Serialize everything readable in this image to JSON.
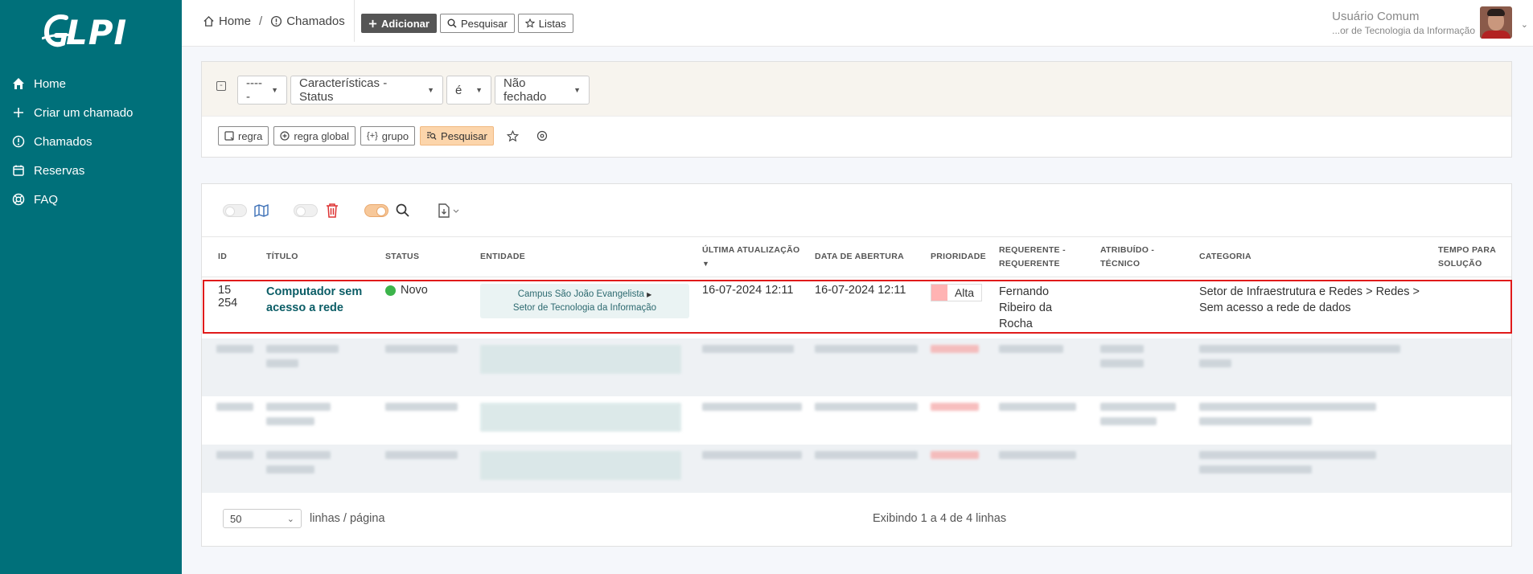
{
  "app": {
    "logo_text": "LPI"
  },
  "sidebar": {
    "items": [
      {
        "label": "Home",
        "icon": "home-icon"
      },
      {
        "label": "Criar um chamado",
        "icon": "plus-icon"
      },
      {
        "label": "Chamados",
        "icon": "alert-circle-icon"
      },
      {
        "label": "Reservas",
        "icon": "calendar-icon"
      },
      {
        "label": "FAQ",
        "icon": "lifebuoy-icon"
      }
    ]
  },
  "header": {
    "breadcrumb": {
      "home": "Home",
      "separator": "/",
      "current": "Chamados"
    },
    "buttons": {
      "add": "Adicionar",
      "search": "Pesquisar",
      "lists": "Listas"
    },
    "user": {
      "name": "Usuário Comum",
      "entity": "...or de Tecnologia da Informação"
    }
  },
  "search": {
    "link_value": "-----",
    "field_value": "Características - Status",
    "operator_value": "é",
    "criteria_value": "Não fechado",
    "buttons": {
      "rule": "regra",
      "global_rule": "regra global",
      "group": "grupo",
      "search": "Pesquisar"
    }
  },
  "table": {
    "headers": {
      "id": "ID",
      "title": "Título",
      "status": "Status",
      "entity": "Entidade",
      "last_update": "Última atualização",
      "opening_date": "Data de abertura",
      "priority": "Prioridade",
      "requester_1": "Requerente -",
      "requester_2": "Requerente",
      "assigned_1": "Atribuído -",
      "assigned_2": "Técnico",
      "category": "Categoria",
      "time_1": "Tempo para",
      "time_2": "solução"
    },
    "row": {
      "id": "15 254",
      "title_1": "Computador sem",
      "title_2": "acesso a rede",
      "status": "Novo",
      "entity_1": "Campus São João Evangelista",
      "entity_2": "Setor de Tecnologia da Informação",
      "last_update": "16-07-2024 12:11",
      "opening_date": "16-07-2024 12:11",
      "priority": "Alta",
      "requester_1": "Fernando",
      "requester_2": "Ribeiro da",
      "requester_3": "Rocha",
      "category_1": "Setor de Infraestrutura e Redes > Redes >",
      "category_2": "Sem acesso a rede de dados"
    }
  },
  "footer": {
    "page_size": "50",
    "rows_label": "linhas / página",
    "showing": "Exibindo 1 a 4 de 4 linhas"
  },
  "colors": {
    "sidebar": "#00707a",
    "status_new": "#3cb44b",
    "priority_high": "#ffb3b3",
    "highlight": "#e01b1b"
  }
}
